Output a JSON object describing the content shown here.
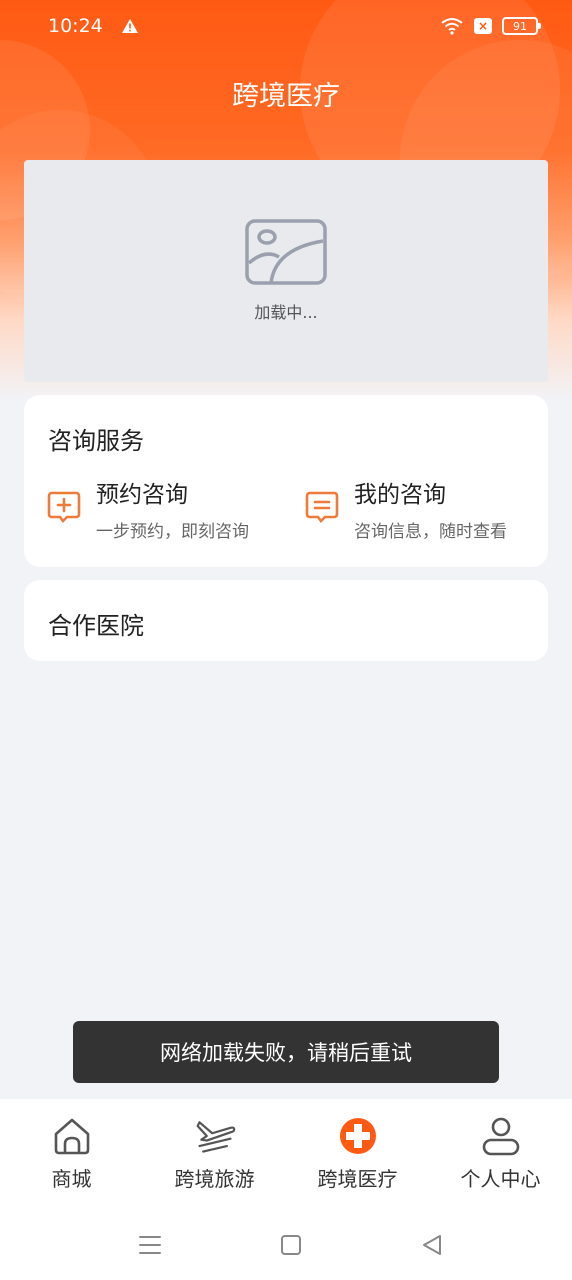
{
  "status_bar": {
    "time": "10:24",
    "battery": "91"
  },
  "header": {
    "title": "跨境医疗"
  },
  "banner": {
    "loading_text": "加载中..."
  },
  "consult_section": {
    "title": "咨询服务",
    "items": [
      {
        "name": "预约咨询",
        "desc": "一步预约，即刻咨询",
        "icon": "chat-plus-icon"
      },
      {
        "name": "我的咨询",
        "desc": "咨询信息，随时查看",
        "icon": "chat-lines-icon"
      }
    ]
  },
  "hospital_section": {
    "title": "合作医院"
  },
  "toast": {
    "text": "网络加载失败，请稍后重试"
  },
  "tabbar": {
    "items": [
      {
        "label": "商城",
        "icon": "home-icon"
      },
      {
        "label": "跨境旅游",
        "icon": "airplane-icon"
      },
      {
        "label": "跨境医疗",
        "icon": "medical-cross-icon",
        "active": true
      },
      {
        "label": "个人中心",
        "icon": "user-icon"
      }
    ]
  },
  "colors": {
    "accent": "#ff5a14",
    "icon_orange": "#f07a3a"
  }
}
